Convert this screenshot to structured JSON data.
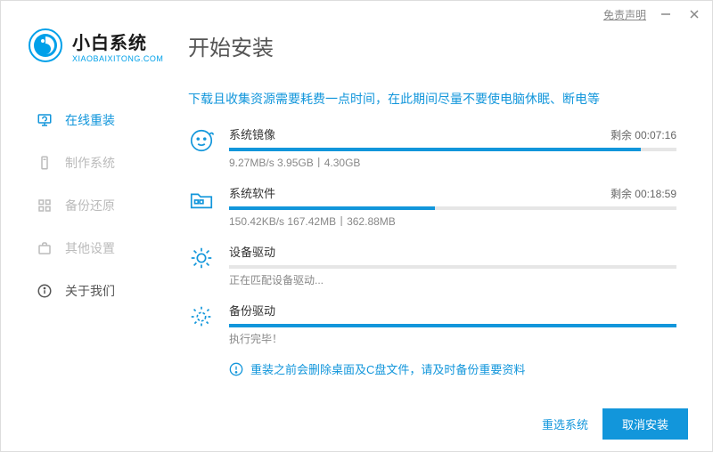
{
  "titlebar": {
    "disclaimer": "免责声明"
  },
  "brand": {
    "cn": "小白系统",
    "en": "XIAOBAIXITONG.COM"
  },
  "page_title": "开始安装",
  "nav": {
    "items": [
      {
        "label": "在线重装"
      },
      {
        "label": "制作系统"
      },
      {
        "label": "备份还原"
      },
      {
        "label": "其他设置"
      },
      {
        "label": "关于我们"
      }
    ]
  },
  "hint_top": "下载且收集资源需要耗费一点时间，在此期间尽量不要使电脑休眠、断电等",
  "tasks": [
    {
      "title": "系统镜像",
      "detail": "9.27MB/s 3.95GB丨4.30GB",
      "remain": "剩余 00:07:16",
      "progress": 92
    },
    {
      "title": "系统软件",
      "detail": "150.42KB/s 167.42MB丨362.88MB",
      "remain": "剩余 00:18:59",
      "progress": 46
    },
    {
      "title": "设备驱动",
      "detail": "正在匹配设备驱动...",
      "remain": "",
      "progress": 0
    },
    {
      "title": "备份驱动",
      "detail": "执行完毕！",
      "remain": "",
      "progress": 100
    }
  ],
  "warning": "重装之前会删除桌面及C盘文件，请及时备份重要资料",
  "footer": {
    "reselect": "重选系统",
    "cancel": "取消安装"
  }
}
